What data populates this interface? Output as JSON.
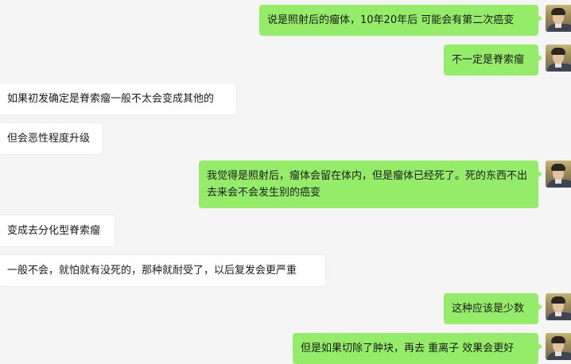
{
  "messages": [
    {
      "text": "说是照射后的瘤体，10年20年后 可能会有第二次癌变"
    },
    {
      "text": "不一定是脊索瘤"
    },
    {
      "text": "如果初发确定是脊索瘤一般不太会变成其他的"
    },
    {
      "text": "但会恶性程度升级"
    },
    {
      "text": "我觉得是照射后，瘤体会留在体内，但是瘤体已经死了。死的东西不出去来会不会发生别的癌变"
    },
    {
      "text": "变成去分化型脊索瘤"
    },
    {
      "text": "一般不会，就怕就有没死的，那种就耐受了，以后复发会更严重"
    },
    {
      "text": "这种应该是少数"
    },
    {
      "text": "但是如果切除了肿块，再去 重离子 效果会更好"
    }
  ],
  "colors": {
    "background": "#f5f5f5",
    "outgoing_bubble": "#95ec69",
    "incoming_bubble": "#ffffff"
  },
  "icons": {
    "avatar": "user-avatar-photo"
  }
}
